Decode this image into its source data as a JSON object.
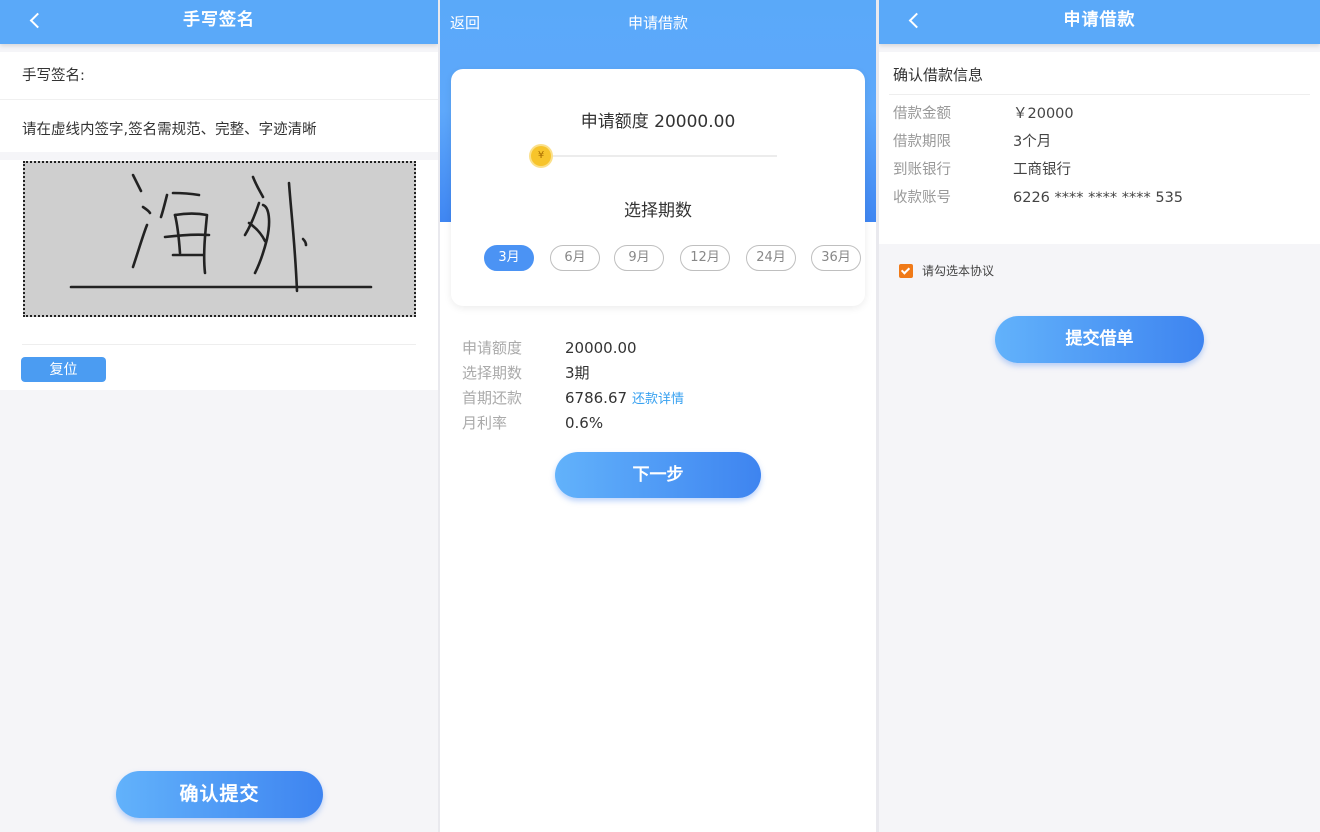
{
  "colors": {
    "primary_blue": "#5aa9f9",
    "button_gradient_start": "#62b2fb",
    "button_gradient_end": "#3e84f0",
    "checkbox_orange": "#f07a18",
    "link_blue": "#38a1f0"
  },
  "signature_screen": {
    "title": "手写签名",
    "back_icon": "chevron-left-icon",
    "label": "手写签名:",
    "instruction": "请在虚线内签字,签名需规范、完整、字迹清晰",
    "reset_label": "复位",
    "confirm_label": "确认提交"
  },
  "apply_screen": {
    "back_label": "返回",
    "title": "申请借款",
    "amount_label": "申请额度",
    "amount_value": "20000.00",
    "slider_icon": "¥",
    "slider_level": 0.0,
    "period_title": "选择期数",
    "periods": [
      "3月",
      "6月",
      "9月",
      "12月",
      "24月",
      "36月"
    ],
    "selected_period_index": 0,
    "summary": {
      "amount_label": "申请额度",
      "amount_value": "20000.00",
      "period_label": "选择期数",
      "period_value": "3期",
      "first_payment_label": "首期还款",
      "first_payment_value": "6786.67",
      "detail_link": "还款详情",
      "rate_label": "月利率",
      "rate_value": "0.6%"
    },
    "next_label": "下一步"
  },
  "confirm_screen": {
    "title": "申请借款",
    "back_icon": "chevron-left-icon",
    "section_title": "确认借款信息",
    "rows": [
      {
        "label": "借款金额",
        "value": "￥20000"
      },
      {
        "label": "借款期限",
        "value": "3个月"
      },
      {
        "label": "到账银行",
        "value": "工商银行"
      },
      {
        "label": "收款账号",
        "value": "6226 **** **** **** 535"
      }
    ],
    "agreement_checked": true,
    "agreement_label": "请勾选本协议",
    "submit_label": "提交借单"
  }
}
